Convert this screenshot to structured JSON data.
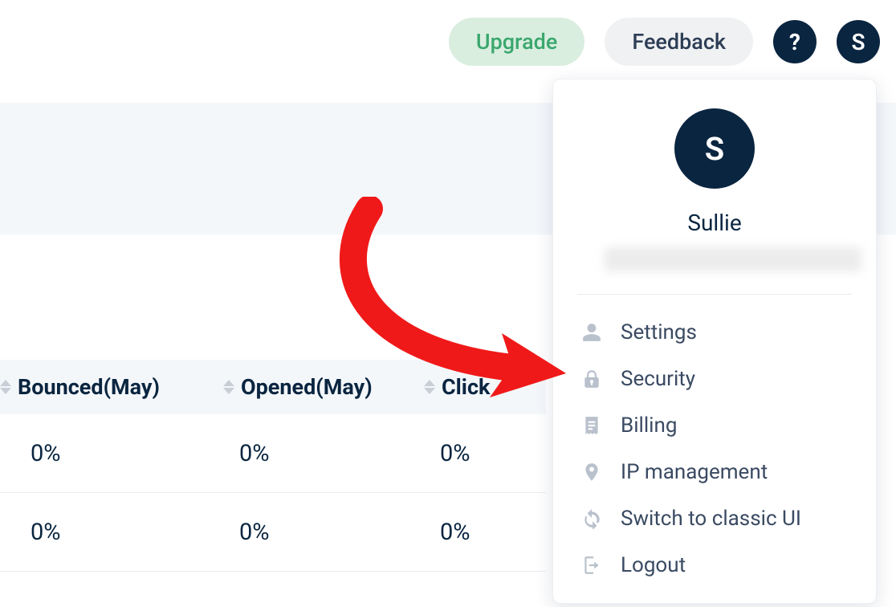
{
  "topbar": {
    "upgrade_label": "Upgrade",
    "feedback_label": "Feedback",
    "help_glyph": "?",
    "avatar_initial": "S"
  },
  "table": {
    "columns": [
      {
        "label": "Bounced(May)"
      },
      {
        "label": "Opened(May)"
      },
      {
        "label": "Click"
      }
    ],
    "rows": [
      {
        "c1": "0%",
        "c2": "0%",
        "c3": "0%"
      },
      {
        "c1": "0%",
        "c2": "0%",
        "c3": "0%"
      }
    ]
  },
  "dropdown": {
    "avatar_initial": "S",
    "name": "Sullie",
    "items": [
      {
        "label": "Settings"
      },
      {
        "label": "Security"
      },
      {
        "label": "Billing"
      },
      {
        "label": "IP management"
      },
      {
        "label": "Switch to classic UI"
      },
      {
        "label": "Logout"
      }
    ]
  }
}
